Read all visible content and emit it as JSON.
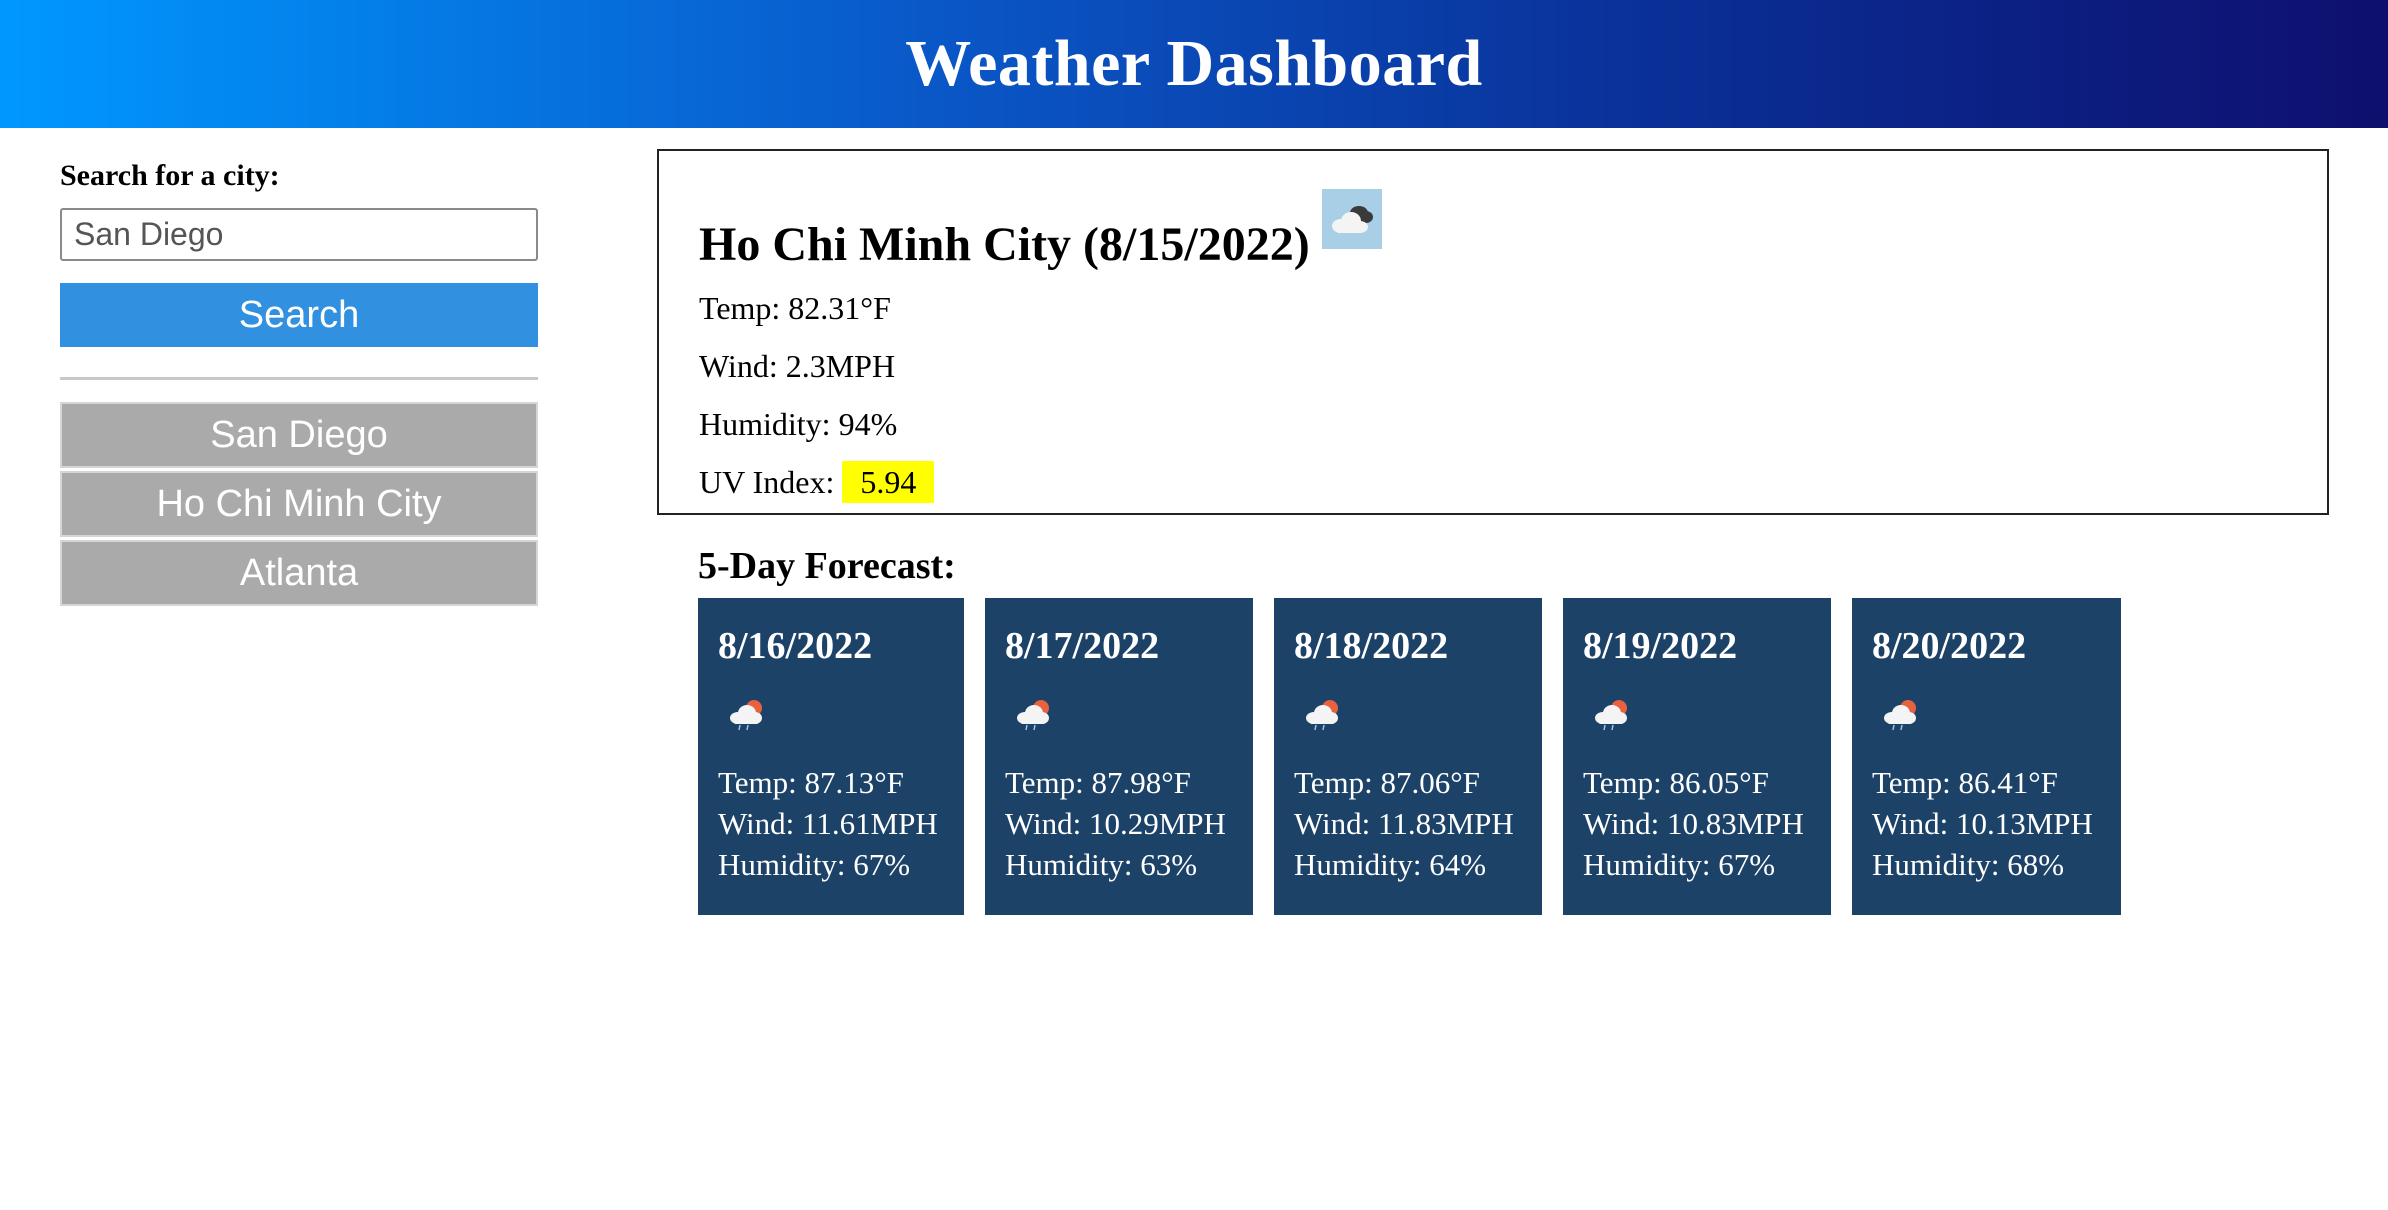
{
  "header": {
    "title": "Weather Dashboard"
  },
  "sidebar": {
    "search_label": "Search for a city:",
    "search_value": "San Diego",
    "search_button": "Search",
    "history": [
      "San Diego",
      "Ho Chi Minh City",
      "Atlanta"
    ]
  },
  "current": {
    "title": "Ho Chi Minh City (8/15/2022)",
    "icon": "broken-clouds-icon",
    "temp": "Temp: 82.31°F",
    "wind": "Wind: 2.3MPH",
    "humidity": "Humidity: 94%",
    "uv_label": "UV Index:",
    "uv_value": "5.94",
    "uv_color": "#ffff00"
  },
  "forecast": {
    "heading": "5-Day Forecast:",
    "card_color": "#1d4268",
    "days": [
      {
        "date": "8/16/2022",
        "icon": "rain-sun-cloud-icon",
        "temp": "Temp: 87.13°F",
        "wind": "Wind: 11.61MPH",
        "humidity": "Humidity: 67%"
      },
      {
        "date": "8/17/2022",
        "icon": "rain-sun-cloud-icon",
        "temp": "Temp: 87.98°F",
        "wind": "Wind: 10.29MPH",
        "humidity": "Humidity: 63%"
      },
      {
        "date": "8/18/2022",
        "icon": "rain-sun-cloud-icon",
        "temp": "Temp: 87.06°F",
        "wind": "Wind: 11.83MPH",
        "humidity": "Humidity: 64%"
      },
      {
        "date": "8/19/2022",
        "icon": "rain-sun-cloud-icon",
        "temp": "Temp: 86.05°F",
        "wind": "Wind: 10.83MPH",
        "humidity": "Humidity: 67%"
      },
      {
        "date": "8/20/2022",
        "icon": "rain-sun-cloud-icon",
        "temp": "Temp: 86.41°F",
        "wind": "Wind: 10.13MPH",
        "humidity": "Humidity: 68%"
      }
    ]
  }
}
